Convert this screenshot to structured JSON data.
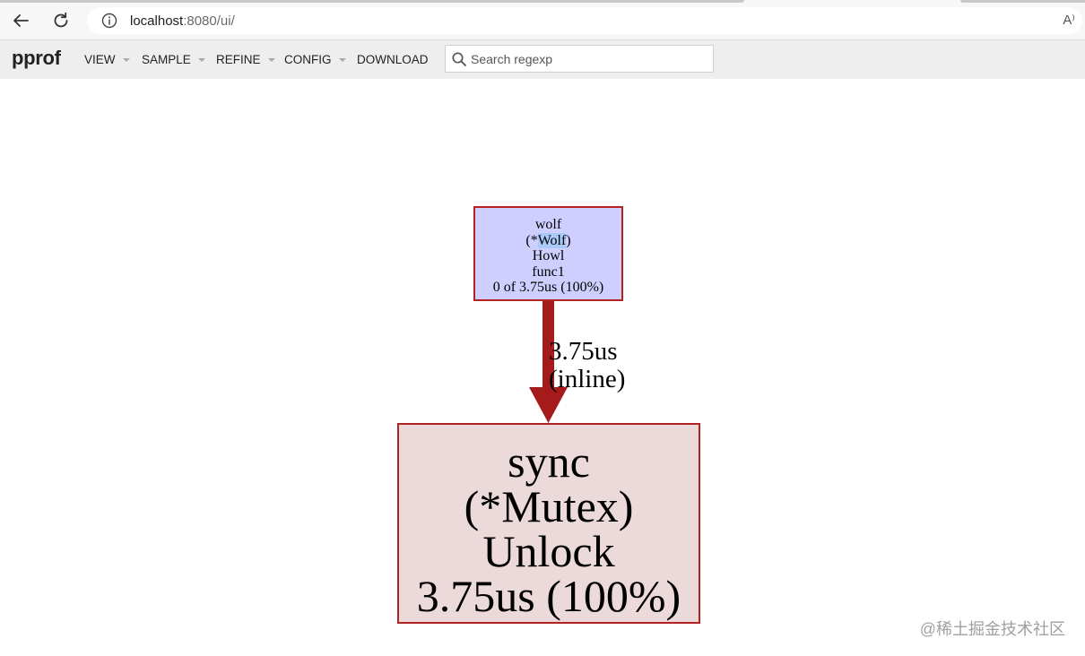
{
  "browser": {
    "url_host": "localhost",
    "url_rest": ":8080/ui/",
    "read_aloud_glyph": "A⁾"
  },
  "header": {
    "logo": "pprof",
    "menu": [
      {
        "label": "VIEW"
      },
      {
        "label": "SAMPLE"
      },
      {
        "label": "REFINE"
      },
      {
        "label": "CONFIG"
      },
      {
        "label": "DOWNLOAD"
      }
    ],
    "search_placeholder": "Search regexp"
  },
  "graph": {
    "caller": {
      "line1": "wolf",
      "line2_prefix": "(*",
      "line2_highlight": "Wolf",
      "line2_suffix": ")",
      "line3": "Howl",
      "line4": "func1",
      "line5": "0 of 3.75us (100%)",
      "fill": "#cfcfff",
      "border": "#b22222"
    },
    "edge": {
      "line1": "3.75us",
      "line2": "(inline)",
      "color": "#a51a1a"
    },
    "callee": {
      "line1": "sync",
      "line2": "(*Mutex)",
      "line3": "Unlock",
      "line4": "3.75us (100%)",
      "fill": "#ecd9d9",
      "border": "#b22222"
    }
  },
  "watermark": "@稀土掘金技术社区",
  "icons": {
    "back": "back-arrow-icon",
    "reload": "reload-icon",
    "info": "info-icon",
    "search": "search-icon",
    "read_aloud": "read-aloud-icon"
  }
}
